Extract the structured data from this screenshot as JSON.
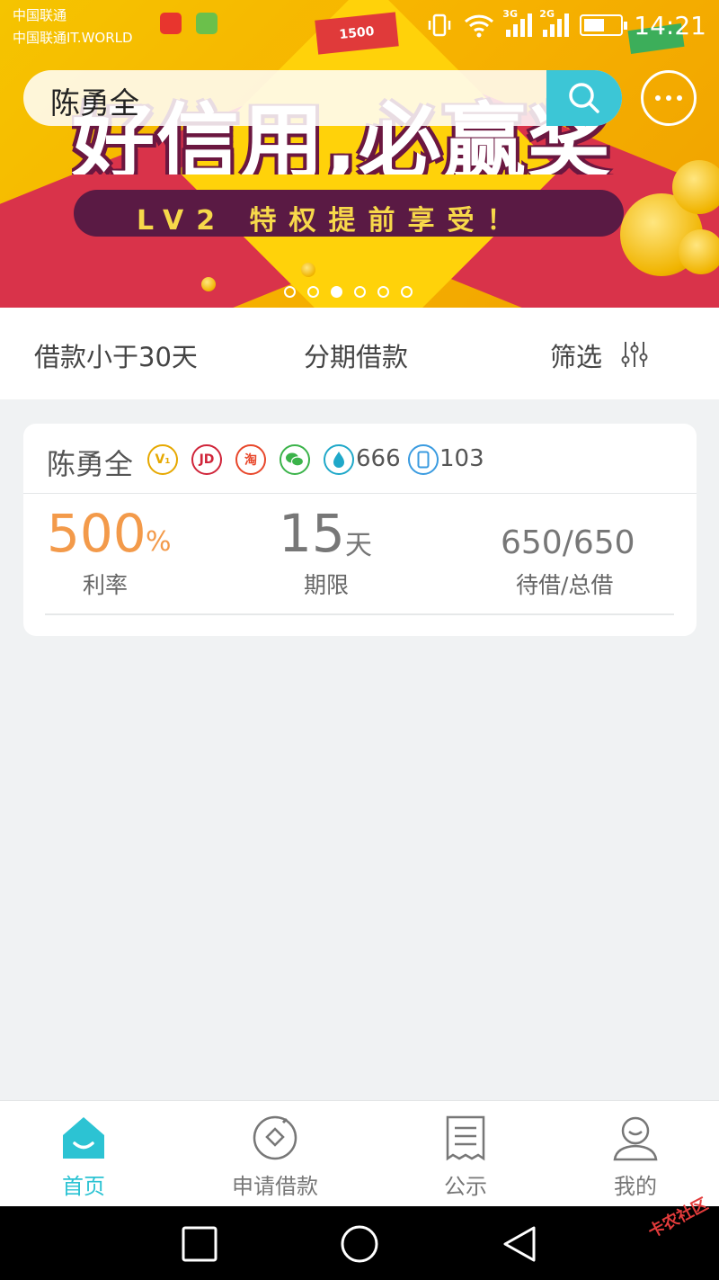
{
  "status_bar": {
    "carrier_1": "中国联通",
    "carrier_2": "中国联通IT.WORLD",
    "net_1": "3G",
    "net_2": "2G",
    "time": "14:21"
  },
  "banner": {
    "headline": "好信用,必赢奖",
    "subline": "LV2 特权提前享受！",
    "red_envelope_text": "1500",
    "carousel": {
      "count": 6,
      "active_index": 2
    },
    "colors": {
      "yellow": "#f5c400",
      "red": "#d9334a",
      "purple": "#5a1a44"
    }
  },
  "search": {
    "value": "陈勇全",
    "button_icon": "search-icon",
    "more_icon": "more-dots-icon",
    "accent": "#3cc6d6"
  },
  "filters": {
    "loan_period": "借款小于30天",
    "installment": "分期借款",
    "screen": "筛选",
    "screen_icon": "filter-sliders-icon"
  },
  "loan_card": {
    "name": "陈勇全",
    "badges": {
      "v1": "V₁",
      "jd": "JD",
      "taobao": "淘",
      "wechat_icon": "wechat-icon",
      "sesame_score": "666",
      "phone_months": "103"
    },
    "rate_value": "500",
    "rate_unit": "%",
    "rate_label": "利率",
    "term_value": "15",
    "term_unit": "天",
    "term_label": "期限",
    "amount_value": "650/650",
    "amount_label": "待借/总借",
    "rate_color": "#f39a4a"
  },
  "tabbar": {
    "tabs": [
      {
        "label": "首页",
        "icon": "home-icon",
        "active": true
      },
      {
        "label": "申请借款",
        "icon": "apply-loan-icon",
        "active": false
      },
      {
        "label": "公示",
        "icon": "notice-icon",
        "active": false
      },
      {
        "label": "我的",
        "icon": "profile-icon",
        "active": false
      }
    ],
    "active_color": "#2cc3d3"
  },
  "watermark": "卡农社区"
}
